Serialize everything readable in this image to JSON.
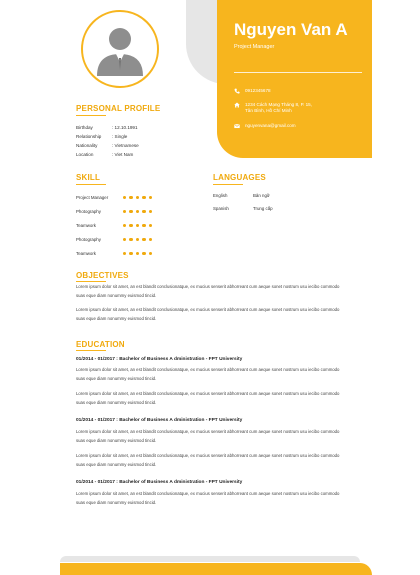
{
  "header": {
    "name": "Nguyen Van A",
    "role": "Project Manager",
    "contacts": [
      {
        "icon": "phone-icon",
        "text": "0912345678"
      },
      {
        "icon": "home-icon",
        "text": "1234 Cách Mạng Tháng 8, P. 15, Tân Bình, Hồ Chí Minh"
      },
      {
        "icon": "mail-icon",
        "text": "nguyenvana@gmail.com"
      }
    ]
  },
  "profile": {
    "title": "PERSONAL PROFILE",
    "rows": [
      {
        "k": "Birthday",
        "v": ": 12.10.1991"
      },
      {
        "k": "Relationship",
        "v": ": Single"
      },
      {
        "k": "Nationality",
        "v": ": Vietnamese"
      },
      {
        "k": "Location",
        "v": ": Viet Nam"
      }
    ]
  },
  "skill": {
    "title": "SKILL",
    "items": [
      {
        "name": "Project Manager",
        "level": 5
      },
      {
        "name": "Photography",
        "level": 5
      },
      {
        "name": "Teamwork",
        "level": 5
      },
      {
        "name": "Photography",
        "level": 5
      },
      {
        "name": "Teamwork",
        "level": 5
      }
    ]
  },
  "languages": {
    "title": "LANGUAGES",
    "items": [
      {
        "name": "English",
        "level": "Bản ngữ"
      },
      {
        "name": "Spanish",
        "level": "Trung cấp"
      }
    ]
  },
  "objectives": {
    "title": "OBJECTIVES",
    "paras": [
      "Lorem ipsum dolor sit amet, an est blandit conclusionatque, ex mucius senserit abhorreant cum aeque sonet nostrum usu iecibo commodo suas eque diam nonummy euismod tincid.",
      "Lorem ipsum dolor sit amet, an est blandit conclusionatque, ex mucius senserit abhorreant cum aeque sonet nostrum usu iecibo commodo suas eque diam nonummy euismod tincid."
    ]
  },
  "education": {
    "title": "EDUCATION",
    "entries": [
      {
        "heading": "01/2014 - 01/2017 : Bachelor of Business A dministration - FPT University",
        "paras": [
          "Lorem ipsum dolor sit amet, an est blandit conclusionatque, ex mucius senserit abhorreant cum aeque sonet nostrum usu iecibo commodo suas eque diam nonummy euismod tincid.",
          "Lorem ipsum dolor sit amet, an est blandit conclusionatque, ex mucius senserit abhorreant cum aeque sonet nostrum usu iecibo commodo suas eque diam nonummy euismod tincid."
        ]
      },
      {
        "heading": "01/2014 - 01/2017 : Bachelor of Business A dministration - FPT University",
        "paras": [
          "Lorem ipsum dolor sit amet, an est blandit conclusionatque, ex mucius senserit abhorreant cum aeque sonet nostrum usu iecibo commodo suas eque diam nonummy euismod tincid.",
          "Lorem ipsum dolor sit amet, an est blandit conclusionatque, ex mucius senserit abhorreant cum aeque sonet nostrum usu iecibo commodo suas eque diam nonummy euismod tincid."
        ]
      },
      {
        "heading": "01/2014 - 01/2017 : Bachelor of Business A dministration - FPT University",
        "paras": [
          "Lorem ipsum dolor sit amet, an est blandit conclusionatque, ex mucius senserit abhorreant cum aeque sonet nostrum usu iecibo commodo suas eque diam nonummy euismod tincid."
        ]
      }
    ]
  },
  "colors": {
    "accent": "#f7b51e",
    "heading": "#f0a90d"
  }
}
